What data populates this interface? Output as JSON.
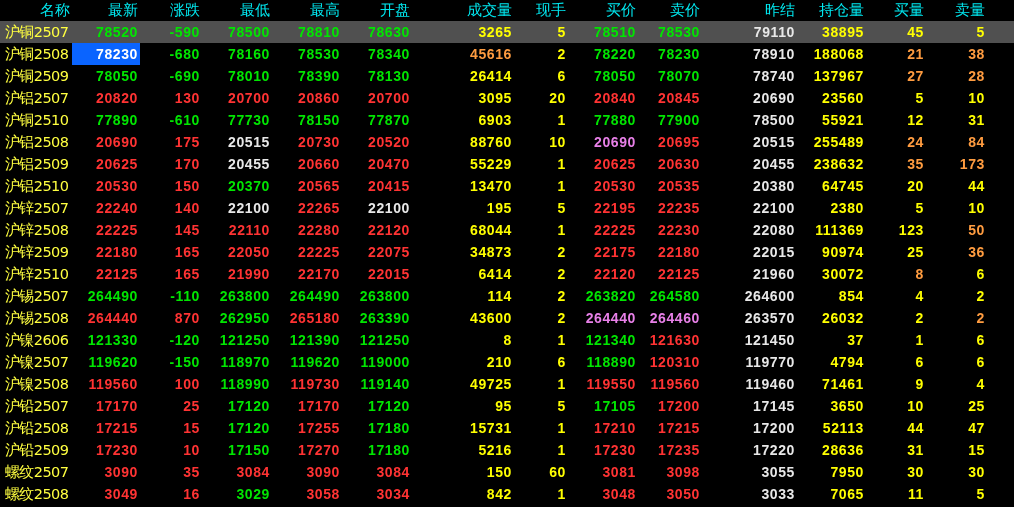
{
  "table": {
    "columns": [
      "名称",
      "最新",
      "涨跌",
      "最低",
      "最高",
      "开盘",
      "成交量",
      "现手",
      "买价",
      "卖价",
      "昨结",
      "持仓量",
      "买量",
      "卖量"
    ],
    "rows": [
      {
        "selected": true,
        "cursor": false,
        "cells": [
          {
            "text": "沪铜2507",
            "color": "#ffff40"
          },
          {
            "text": "78520",
            "color": "#00e600"
          },
          {
            "text": "-590",
            "color": "#00e600"
          },
          {
            "text": "78500",
            "color": "#00e600"
          },
          {
            "text": "78810",
            "color": "#00e600"
          },
          {
            "text": "78630",
            "color": "#00e600"
          },
          {
            "text": "3265",
            "color": "#ffff00"
          },
          {
            "text": "5",
            "color": "#ffff00"
          },
          {
            "text": "78510",
            "color": "#00e600"
          },
          {
            "text": "78530",
            "color": "#00e600"
          },
          {
            "text": "79110",
            "color": "#e8e8e8"
          },
          {
            "text": "38895",
            "color": "#ffff00"
          },
          {
            "text": "45",
            "color": "#ffff00"
          },
          {
            "text": "5",
            "color": "#ffff00"
          }
        ]
      },
      {
        "selected": false,
        "cursor": true,
        "cells": [
          {
            "text": "沪铜2508",
            "color": "#ffff40"
          },
          {
            "text": "78230",
            "color": "#ffffff"
          },
          {
            "text": "-680",
            "color": "#00e600"
          },
          {
            "text": "78160",
            "color": "#00e600"
          },
          {
            "text": "78530",
            "color": "#00e600"
          },
          {
            "text": "78340",
            "color": "#00e600"
          },
          {
            "text": "45616",
            "color": "#ff9c40"
          },
          {
            "text": "2",
            "color": "#ffff00"
          },
          {
            "text": "78220",
            "color": "#00e600"
          },
          {
            "text": "78230",
            "color": "#00e600"
          },
          {
            "text": "78910",
            "color": "#e8e8e8"
          },
          {
            "text": "188068",
            "color": "#ffff00"
          },
          {
            "text": "21",
            "color": "#ff9c40"
          },
          {
            "text": "38",
            "color": "#ff9c40"
          }
        ]
      },
      {
        "selected": false,
        "cursor": false,
        "cells": [
          {
            "text": "沪铜2509",
            "color": "#ffff40"
          },
          {
            "text": "78050",
            "color": "#00e600"
          },
          {
            "text": "-690",
            "color": "#00e600"
          },
          {
            "text": "78010",
            "color": "#00e600"
          },
          {
            "text": "78390",
            "color": "#00e600"
          },
          {
            "text": "78130",
            "color": "#00e600"
          },
          {
            "text": "26414",
            "color": "#ffff00"
          },
          {
            "text": "6",
            "color": "#ffff00"
          },
          {
            "text": "78050",
            "color": "#00e600"
          },
          {
            "text": "78070",
            "color": "#00e600"
          },
          {
            "text": "78740",
            "color": "#e8e8e8"
          },
          {
            "text": "137967",
            "color": "#ffff00"
          },
          {
            "text": "27",
            "color": "#ff9c40"
          },
          {
            "text": "28",
            "color": "#ff9c40"
          }
        ]
      },
      {
        "selected": false,
        "cursor": false,
        "cells": [
          {
            "text": "沪铝2507",
            "color": "#ffff40"
          },
          {
            "text": "20820",
            "color": "#ff3333"
          },
          {
            "text": "130",
            "color": "#ff3333"
          },
          {
            "text": "20700",
            "color": "#ff3333"
          },
          {
            "text": "20860",
            "color": "#ff3333"
          },
          {
            "text": "20700",
            "color": "#ff3333"
          },
          {
            "text": "3095",
            "color": "#ffff00"
          },
          {
            "text": "20",
            "color": "#ffff00"
          },
          {
            "text": "20840",
            "color": "#ff3333"
          },
          {
            "text": "20845",
            "color": "#ff3333"
          },
          {
            "text": "20690",
            "color": "#e8e8e8"
          },
          {
            "text": "23560",
            "color": "#ffff00"
          },
          {
            "text": "5",
            "color": "#ffff00"
          },
          {
            "text": "10",
            "color": "#ffff00"
          }
        ]
      },
      {
        "selected": false,
        "cursor": false,
        "cells": [
          {
            "text": "沪铜2510",
            "color": "#ffff40"
          },
          {
            "text": "77890",
            "color": "#00e600"
          },
          {
            "text": "-610",
            "color": "#00e600"
          },
          {
            "text": "77730",
            "color": "#00e600"
          },
          {
            "text": "78150",
            "color": "#00e600"
          },
          {
            "text": "77870",
            "color": "#00e600"
          },
          {
            "text": "6903",
            "color": "#ffff00"
          },
          {
            "text": "1",
            "color": "#ffff00"
          },
          {
            "text": "77880",
            "color": "#00e600"
          },
          {
            "text": "77900",
            "color": "#00e600"
          },
          {
            "text": "78500",
            "color": "#e8e8e8"
          },
          {
            "text": "55921",
            "color": "#ffff00"
          },
          {
            "text": "12",
            "color": "#ffff00"
          },
          {
            "text": "31",
            "color": "#ffff00"
          }
        ]
      },
      {
        "selected": false,
        "cursor": false,
        "cells": [
          {
            "text": "沪铝2508",
            "color": "#ffff40"
          },
          {
            "text": "20690",
            "color": "#ff3333"
          },
          {
            "text": "175",
            "color": "#ff3333"
          },
          {
            "text": "20515",
            "color": "#e8e8e8"
          },
          {
            "text": "20730",
            "color": "#ff3333"
          },
          {
            "text": "20520",
            "color": "#ff3333"
          },
          {
            "text": "88760",
            "color": "#ffff00"
          },
          {
            "text": "10",
            "color": "#ffff00"
          },
          {
            "text": "20690",
            "color": "#e880e8"
          },
          {
            "text": "20695",
            "color": "#ff3333"
          },
          {
            "text": "20515",
            "color": "#e8e8e8"
          },
          {
            "text": "255489",
            "color": "#ffff00"
          },
          {
            "text": "24",
            "color": "#ff9c40"
          },
          {
            "text": "84",
            "color": "#ff9c40"
          }
        ]
      },
      {
        "selected": false,
        "cursor": false,
        "cells": [
          {
            "text": "沪铝2509",
            "color": "#ffff40"
          },
          {
            "text": "20625",
            "color": "#ff3333"
          },
          {
            "text": "170",
            "color": "#ff3333"
          },
          {
            "text": "20455",
            "color": "#e8e8e8"
          },
          {
            "text": "20660",
            "color": "#ff3333"
          },
          {
            "text": "20470",
            "color": "#ff3333"
          },
          {
            "text": "55229",
            "color": "#ffff00"
          },
          {
            "text": "1",
            "color": "#ffff00"
          },
          {
            "text": "20625",
            "color": "#ff3333"
          },
          {
            "text": "20630",
            "color": "#ff3333"
          },
          {
            "text": "20455",
            "color": "#e8e8e8"
          },
          {
            "text": "238632",
            "color": "#ffff00"
          },
          {
            "text": "35",
            "color": "#ff9c40"
          },
          {
            "text": "173",
            "color": "#ff9c40"
          }
        ]
      },
      {
        "selected": false,
        "cursor": false,
        "cells": [
          {
            "text": "沪铝2510",
            "color": "#ffff40"
          },
          {
            "text": "20530",
            "color": "#ff3333"
          },
          {
            "text": "150",
            "color": "#ff3333"
          },
          {
            "text": "20370",
            "color": "#00e600"
          },
          {
            "text": "20565",
            "color": "#ff3333"
          },
          {
            "text": "20415",
            "color": "#ff3333"
          },
          {
            "text": "13470",
            "color": "#ffff00"
          },
          {
            "text": "1",
            "color": "#ffff00"
          },
          {
            "text": "20530",
            "color": "#ff3333"
          },
          {
            "text": "20535",
            "color": "#ff3333"
          },
          {
            "text": "20380",
            "color": "#e8e8e8"
          },
          {
            "text": "64745",
            "color": "#ffff00"
          },
          {
            "text": "20",
            "color": "#ffff00"
          },
          {
            "text": "44",
            "color": "#ffff00"
          }
        ]
      },
      {
        "selected": false,
        "cursor": false,
        "cells": [
          {
            "text": "沪锌2507",
            "color": "#ffff40"
          },
          {
            "text": "22240",
            "color": "#ff3333"
          },
          {
            "text": "140",
            "color": "#ff3333"
          },
          {
            "text": "22100",
            "color": "#e8e8e8"
          },
          {
            "text": "22265",
            "color": "#ff3333"
          },
          {
            "text": "22100",
            "color": "#e8e8e8"
          },
          {
            "text": "195",
            "color": "#ffff00"
          },
          {
            "text": "5",
            "color": "#ffff00"
          },
          {
            "text": "22195",
            "color": "#ff3333"
          },
          {
            "text": "22235",
            "color": "#ff3333"
          },
          {
            "text": "22100",
            "color": "#e8e8e8"
          },
          {
            "text": "2380",
            "color": "#ffff00"
          },
          {
            "text": "5",
            "color": "#ffff00"
          },
          {
            "text": "10",
            "color": "#ffff00"
          }
        ]
      },
      {
        "selected": false,
        "cursor": false,
        "cells": [
          {
            "text": "沪锌2508",
            "color": "#ffff40"
          },
          {
            "text": "22225",
            "color": "#ff3333"
          },
          {
            "text": "145",
            "color": "#ff3333"
          },
          {
            "text": "22110",
            "color": "#ff3333"
          },
          {
            "text": "22280",
            "color": "#ff3333"
          },
          {
            "text": "22120",
            "color": "#ff3333"
          },
          {
            "text": "68044",
            "color": "#ffff00"
          },
          {
            "text": "1",
            "color": "#ffff00"
          },
          {
            "text": "22225",
            "color": "#ff3333"
          },
          {
            "text": "22230",
            "color": "#ff3333"
          },
          {
            "text": "22080",
            "color": "#e8e8e8"
          },
          {
            "text": "111369",
            "color": "#ffff00"
          },
          {
            "text": "123",
            "color": "#ffff00"
          },
          {
            "text": "50",
            "color": "#ff9c40"
          }
        ]
      },
      {
        "selected": false,
        "cursor": false,
        "cells": [
          {
            "text": "沪锌2509",
            "color": "#ffff40"
          },
          {
            "text": "22180",
            "color": "#ff3333"
          },
          {
            "text": "165",
            "color": "#ff3333"
          },
          {
            "text": "22050",
            "color": "#ff3333"
          },
          {
            "text": "22225",
            "color": "#ff3333"
          },
          {
            "text": "22075",
            "color": "#ff3333"
          },
          {
            "text": "34873",
            "color": "#ffff00"
          },
          {
            "text": "2",
            "color": "#ffff00"
          },
          {
            "text": "22175",
            "color": "#ff3333"
          },
          {
            "text": "22180",
            "color": "#ff3333"
          },
          {
            "text": "22015",
            "color": "#e8e8e8"
          },
          {
            "text": "90974",
            "color": "#ffff00"
          },
          {
            "text": "25",
            "color": "#ffff00"
          },
          {
            "text": "36",
            "color": "#ff9c40"
          }
        ]
      },
      {
        "selected": false,
        "cursor": false,
        "cells": [
          {
            "text": "沪锌2510",
            "color": "#ffff40"
          },
          {
            "text": "22125",
            "color": "#ff3333"
          },
          {
            "text": "165",
            "color": "#ff3333"
          },
          {
            "text": "21990",
            "color": "#ff3333"
          },
          {
            "text": "22170",
            "color": "#ff3333"
          },
          {
            "text": "22015",
            "color": "#ff3333"
          },
          {
            "text": "6414",
            "color": "#ffff00"
          },
          {
            "text": "2",
            "color": "#ffff00"
          },
          {
            "text": "22120",
            "color": "#ff3333"
          },
          {
            "text": "22125",
            "color": "#ff3333"
          },
          {
            "text": "21960",
            "color": "#e8e8e8"
          },
          {
            "text": "30072",
            "color": "#ffff00"
          },
          {
            "text": "8",
            "color": "#ff9c40"
          },
          {
            "text": "6",
            "color": "#ffff00"
          }
        ]
      },
      {
        "selected": false,
        "cursor": false,
        "cells": [
          {
            "text": "沪锡2507",
            "color": "#ffff40"
          },
          {
            "text": "264490",
            "color": "#00e600"
          },
          {
            "text": "-110",
            "color": "#00e600"
          },
          {
            "text": "263800",
            "color": "#00e600"
          },
          {
            "text": "264490",
            "color": "#00e600"
          },
          {
            "text": "263800",
            "color": "#00e600"
          },
          {
            "text": "114",
            "color": "#ffff00"
          },
          {
            "text": "2",
            "color": "#ffff00"
          },
          {
            "text": "263820",
            "color": "#00e600"
          },
          {
            "text": "264580",
            "color": "#00e600"
          },
          {
            "text": "264600",
            "color": "#e8e8e8"
          },
          {
            "text": "854",
            "color": "#ffff00"
          },
          {
            "text": "4",
            "color": "#ffff00"
          },
          {
            "text": "2",
            "color": "#ffff00"
          }
        ]
      },
      {
        "selected": false,
        "cursor": false,
        "cells": [
          {
            "text": "沪锡2508",
            "color": "#ffff40"
          },
          {
            "text": "264440",
            "color": "#ff3333"
          },
          {
            "text": "870",
            "color": "#ff3333"
          },
          {
            "text": "262950",
            "color": "#00e600"
          },
          {
            "text": "265180",
            "color": "#ff3333"
          },
          {
            "text": "263390",
            "color": "#00e600"
          },
          {
            "text": "43600",
            "color": "#ffff00"
          },
          {
            "text": "2",
            "color": "#ffff00"
          },
          {
            "text": "264440",
            "color": "#e880e8"
          },
          {
            "text": "264460",
            "color": "#e880e8"
          },
          {
            "text": "263570",
            "color": "#e8e8e8"
          },
          {
            "text": "26032",
            "color": "#ffff00"
          },
          {
            "text": "2",
            "color": "#ffff00"
          },
          {
            "text": "2",
            "color": "#ff9c40"
          }
        ]
      },
      {
        "selected": false,
        "cursor": false,
        "cells": [
          {
            "text": "沪镍2606",
            "color": "#ffff40"
          },
          {
            "text": "121330",
            "color": "#00e600"
          },
          {
            "text": "-120",
            "color": "#00e600"
          },
          {
            "text": "121250",
            "color": "#00e600"
          },
          {
            "text": "121390",
            "color": "#00e600"
          },
          {
            "text": "121250",
            "color": "#00e600"
          },
          {
            "text": "8",
            "color": "#ffff00"
          },
          {
            "text": "1",
            "color": "#ffff00"
          },
          {
            "text": "121340",
            "color": "#00e600"
          },
          {
            "text": "121630",
            "color": "#ff3333"
          },
          {
            "text": "121450",
            "color": "#e8e8e8"
          },
          {
            "text": "37",
            "color": "#ffff00"
          },
          {
            "text": "1",
            "color": "#ffff00"
          },
          {
            "text": "6",
            "color": "#ffff00"
          }
        ]
      },
      {
        "selected": false,
        "cursor": false,
        "cells": [
          {
            "text": "沪镍2507",
            "color": "#ffff40"
          },
          {
            "text": "119620",
            "color": "#00e600"
          },
          {
            "text": "-150",
            "color": "#00e600"
          },
          {
            "text": "118970",
            "color": "#00e600"
          },
          {
            "text": "119620",
            "color": "#00e600"
          },
          {
            "text": "119000",
            "color": "#00e600"
          },
          {
            "text": "210",
            "color": "#ffff00"
          },
          {
            "text": "6",
            "color": "#ffff00"
          },
          {
            "text": "118890",
            "color": "#00e600"
          },
          {
            "text": "120310",
            "color": "#ff3333"
          },
          {
            "text": "119770",
            "color": "#e8e8e8"
          },
          {
            "text": "4794",
            "color": "#ffff00"
          },
          {
            "text": "6",
            "color": "#ffff00"
          },
          {
            "text": "6",
            "color": "#ffff00"
          }
        ]
      },
      {
        "selected": false,
        "cursor": false,
        "cells": [
          {
            "text": "沪镍2508",
            "color": "#ffff40"
          },
          {
            "text": "119560",
            "color": "#ff3333"
          },
          {
            "text": "100",
            "color": "#ff3333"
          },
          {
            "text": "118990",
            "color": "#00e600"
          },
          {
            "text": "119730",
            "color": "#ff3333"
          },
          {
            "text": "119140",
            "color": "#00e600"
          },
          {
            "text": "49725",
            "color": "#ffff00"
          },
          {
            "text": "1",
            "color": "#ffff00"
          },
          {
            "text": "119550",
            "color": "#ff3333"
          },
          {
            "text": "119560",
            "color": "#ff3333"
          },
          {
            "text": "119460",
            "color": "#e8e8e8"
          },
          {
            "text": "71461",
            "color": "#ffff00"
          },
          {
            "text": "9",
            "color": "#ffff00"
          },
          {
            "text": "4",
            "color": "#ffff00"
          }
        ]
      },
      {
        "selected": false,
        "cursor": false,
        "cells": [
          {
            "text": "沪铅2507",
            "color": "#ffff40"
          },
          {
            "text": "17170",
            "color": "#ff3333"
          },
          {
            "text": "25",
            "color": "#ff3333"
          },
          {
            "text": "17120",
            "color": "#00e600"
          },
          {
            "text": "17170",
            "color": "#ff3333"
          },
          {
            "text": "17120",
            "color": "#00e600"
          },
          {
            "text": "95",
            "color": "#ffff00"
          },
          {
            "text": "5",
            "color": "#ffff00"
          },
          {
            "text": "17105",
            "color": "#00e600"
          },
          {
            "text": "17200",
            "color": "#ff3333"
          },
          {
            "text": "17145",
            "color": "#e8e8e8"
          },
          {
            "text": "3650",
            "color": "#ffff00"
          },
          {
            "text": "10",
            "color": "#ffff00"
          },
          {
            "text": "25",
            "color": "#ffff00"
          }
        ]
      },
      {
        "selected": false,
        "cursor": false,
        "cells": [
          {
            "text": "沪铅2508",
            "color": "#ffff40"
          },
          {
            "text": "17215",
            "color": "#ff3333"
          },
          {
            "text": "15",
            "color": "#ff3333"
          },
          {
            "text": "17120",
            "color": "#00e600"
          },
          {
            "text": "17255",
            "color": "#ff3333"
          },
          {
            "text": "17180",
            "color": "#00e600"
          },
          {
            "text": "15731",
            "color": "#ffff00"
          },
          {
            "text": "1",
            "color": "#ffff00"
          },
          {
            "text": "17210",
            "color": "#ff3333"
          },
          {
            "text": "17215",
            "color": "#ff3333"
          },
          {
            "text": "17200",
            "color": "#e8e8e8"
          },
          {
            "text": "52113",
            "color": "#ffff00"
          },
          {
            "text": "44",
            "color": "#ffff00"
          },
          {
            "text": "47",
            "color": "#ffff00"
          }
        ]
      },
      {
        "selected": false,
        "cursor": false,
        "cells": [
          {
            "text": "沪铅2509",
            "color": "#ffff40"
          },
          {
            "text": "17230",
            "color": "#ff3333"
          },
          {
            "text": "10",
            "color": "#ff3333"
          },
          {
            "text": "17150",
            "color": "#00e600"
          },
          {
            "text": "17270",
            "color": "#ff3333"
          },
          {
            "text": "17180",
            "color": "#00e600"
          },
          {
            "text": "5216",
            "color": "#ffff00"
          },
          {
            "text": "1",
            "color": "#ffff00"
          },
          {
            "text": "17230",
            "color": "#ff3333"
          },
          {
            "text": "17235",
            "color": "#ff3333"
          },
          {
            "text": "17220",
            "color": "#e8e8e8"
          },
          {
            "text": "28636",
            "color": "#ffff00"
          },
          {
            "text": "31",
            "color": "#ffff00"
          },
          {
            "text": "15",
            "color": "#ffff00"
          }
        ]
      },
      {
        "selected": false,
        "cursor": false,
        "cells": [
          {
            "text": "螺纹2507",
            "color": "#ffff40"
          },
          {
            "text": "3090",
            "color": "#ff3333"
          },
          {
            "text": "35",
            "color": "#ff3333"
          },
          {
            "text": "3084",
            "color": "#ff3333"
          },
          {
            "text": "3090",
            "color": "#ff3333"
          },
          {
            "text": "3084",
            "color": "#ff3333"
          },
          {
            "text": "150",
            "color": "#ffff00"
          },
          {
            "text": "60",
            "color": "#ffff00"
          },
          {
            "text": "3081",
            "color": "#ff3333"
          },
          {
            "text": "3098",
            "color": "#ff3333"
          },
          {
            "text": "3055",
            "color": "#e8e8e8"
          },
          {
            "text": "7950",
            "color": "#ffff00"
          },
          {
            "text": "30",
            "color": "#ffff00"
          },
          {
            "text": "30",
            "color": "#ffff00"
          }
        ]
      },
      {
        "selected": false,
        "cursor": false,
        "cells": [
          {
            "text": "螺纹2508",
            "color": "#ffff40"
          },
          {
            "text": "3049",
            "color": "#ff3333"
          },
          {
            "text": "16",
            "color": "#ff3333"
          },
          {
            "text": "3029",
            "color": "#00e600"
          },
          {
            "text": "3058",
            "color": "#ff3333"
          },
          {
            "text": "3034",
            "color": "#ff3333"
          },
          {
            "text": "842",
            "color": "#ffff00"
          },
          {
            "text": "1",
            "color": "#ffff00"
          },
          {
            "text": "3048",
            "color": "#ff3333"
          },
          {
            "text": "3050",
            "color": "#ff3333"
          },
          {
            "text": "3033",
            "color": "#e8e8e8"
          },
          {
            "text": "7065",
            "color": "#ffff00"
          },
          {
            "text": "11",
            "color": "#ffff00"
          },
          {
            "text": "5",
            "color": "#ffff00"
          }
        ]
      }
    ]
  }
}
